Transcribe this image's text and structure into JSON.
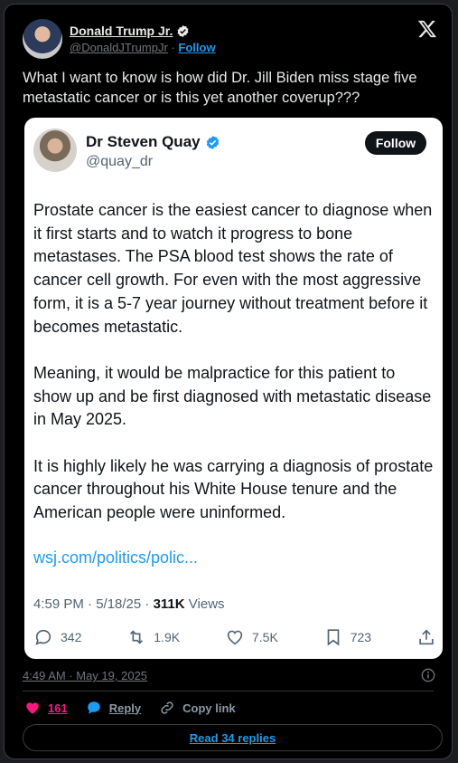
{
  "author": {
    "name": "Donald Trump Jr.",
    "handle": "@DonaldJTrumpJr",
    "separator": "·",
    "follow_label": "Follow"
  },
  "tweet": {
    "text": "What I want to know is how did Dr. Jill Biden miss stage five metastatic cancer or is this yet another coverup???"
  },
  "quoted": {
    "name": "Dr Steven Quay",
    "handle": "@quay_dr",
    "follow_label": "Follow",
    "paragraphs": [
      "Prostate cancer is the easiest cancer to diagnose when it first starts and to watch it progress to bone metastases. The PSA blood test shows the rate of cancer cell growth. For even with the most aggressive form, it is a 5-7 year journey without treatment before it becomes metastatic.",
      "Meaning, it would be malpractice for this patient to show up and be first diagnosed with metastatic disease in May 2025.",
      "It is highly likely he was carrying a diagnosis of prostate cancer throughout his White House tenure and the American people were uninformed."
    ],
    "link": "wsj.com/politics/polic...",
    "meta_time": "4:59 PM · 5/18/25 · ",
    "views_count": "311K",
    "views_label": " Views",
    "actions": {
      "replies": "342",
      "reposts": "1.9K",
      "likes": "7.5K",
      "bookmarks": "723"
    }
  },
  "footer": {
    "timestamp": "4:49 AM · May 19, 2025",
    "likes": "161",
    "reply_label": "Reply",
    "copy_link_label": "Copy link",
    "read_replies_label": "Read 34 replies"
  },
  "colors": {
    "accent": "#1d9bf0",
    "like": "#f91880",
    "background": "#000000"
  }
}
